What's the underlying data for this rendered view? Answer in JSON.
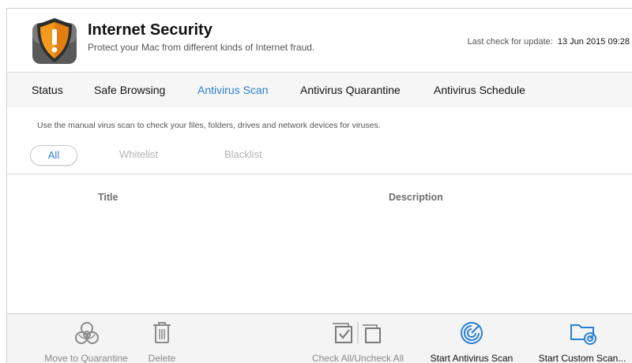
{
  "header": {
    "title": "Internet Security",
    "subtitle": "Protect your Mac from different kinds of Internet fraud.",
    "update_label": "Last check for update:",
    "update_value": "13 Jun 2015 09:28"
  },
  "tabs": [
    {
      "label": "Status",
      "active": false
    },
    {
      "label": "Safe Browsing",
      "active": false
    },
    {
      "label": "Antivirus Scan",
      "active": true
    },
    {
      "label": "Antivirus Quarantine",
      "active": false
    },
    {
      "label": "Antivirus Schedule",
      "active": false
    }
  ],
  "scan": {
    "description": "Use the manual virus scan to check your files, folders, drives and network devices for viruses.",
    "filters": [
      {
        "label": "All",
        "active": true
      },
      {
        "label": "Whitelist",
        "active": false
      },
      {
        "label": "Blacklist",
        "active": false
      }
    ]
  },
  "table": {
    "columns": [
      "Title",
      "Description"
    ],
    "rows": []
  },
  "toolbar": {
    "move_to_quarantine": "Move to Quarantine",
    "delete": "Delete",
    "check_all": "Check All/Uncheck All",
    "start_antivirus_scan": "Start Antivirus Scan",
    "start_custom_scan": "Start Custom Scan..."
  },
  "icons": {
    "app_logo": "warning-shield-icon",
    "quarantine": "biohazard-icon",
    "delete": "trash-icon",
    "check_all": "check-boxes-icon",
    "antivirus_scan": "radar-icon",
    "custom_scan": "folder-scan-icon"
  },
  "colors": {
    "accent": "#2a7fd4",
    "shield_orange": "#f39a1e",
    "shield_dark": "#3a3a3a"
  }
}
